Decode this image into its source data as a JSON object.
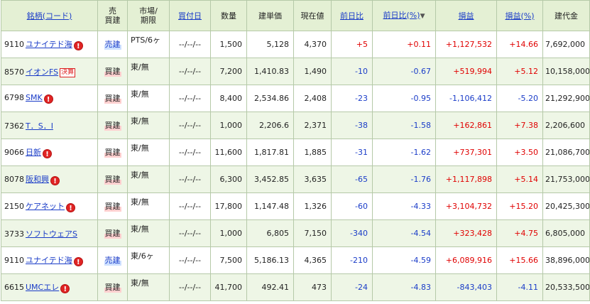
{
  "columns": {
    "name": "銘柄(コード)",
    "side": [
      "売",
      "買建"
    ],
    "market": [
      "市場/",
      "期限"
    ],
    "date": "買付日",
    "qty": "数量",
    "cost": "建単価",
    "price": "現在値",
    "chg": "前日比",
    "chg_pct": "前日比(%)",
    "sort_icon": "▼",
    "pl": "損益",
    "pl_pct": "損益(%)",
    "amount": "建代金"
  },
  "rows": [
    {
      "code": "9110",
      "name": "ユナイテド海",
      "alert": "!",
      "badge": "",
      "side": "売建",
      "side_type": "sell",
      "market": "PTS/6ヶ",
      "date": "--/--/--",
      "qty": "1,500",
      "cost": "5,128",
      "price": "4,370",
      "chg": "+5",
      "chg_sign": "pos",
      "chg_pct": "+0.11",
      "chg_pct_sign": "pos",
      "pl": "+1,127,532",
      "pl_sign": "pos",
      "pl_pct": "+14.66",
      "pl_pct_sign": "pos",
      "amount": "7,692,000"
    },
    {
      "code": "8570",
      "name": "イオンFS",
      "alert": "",
      "badge": "決算",
      "side": "買建",
      "side_type": "buy",
      "market": "東/無",
      "date": "--/--/--",
      "qty": "7,200",
      "cost": "1,410.83",
      "price": "1,490",
      "chg": "-10",
      "chg_sign": "neg",
      "chg_pct": "-0.67",
      "chg_pct_sign": "neg",
      "pl": "+519,994",
      "pl_sign": "pos",
      "pl_pct": "+5.12",
      "pl_pct_sign": "pos",
      "amount": "10,158,000"
    },
    {
      "code": "6798",
      "name": "SMK",
      "alert": "!",
      "badge": "",
      "side": "買建",
      "side_type": "buy",
      "market": "東/無",
      "date": "--/--/--",
      "qty": "8,400",
      "cost": "2,534.86",
      "price": "2,408",
      "chg": "-23",
      "chg_sign": "neg",
      "chg_pct": "-0.95",
      "chg_pct_sign": "neg",
      "pl": "-1,106,412",
      "pl_sign": "neg",
      "pl_pct": "-5.20",
      "pl_pct_sign": "neg",
      "amount": "21,292,900"
    },
    {
      "code": "7362",
      "name": "T．S．I",
      "alert": "",
      "badge": "",
      "side": "買建",
      "side_type": "buy",
      "market": "東/無",
      "date": "--/--/--",
      "qty": "1,000",
      "cost": "2,206.6",
      "price": "2,371",
      "chg": "-38",
      "chg_sign": "neg",
      "chg_pct": "-1.58",
      "chg_pct_sign": "neg",
      "pl": "+162,861",
      "pl_sign": "pos",
      "pl_pct": "+7.38",
      "pl_pct_sign": "pos",
      "amount": "2,206,600"
    },
    {
      "code": "9066",
      "name": "日新",
      "alert": "!",
      "badge": "",
      "side": "買建",
      "side_type": "buy",
      "market": "東/無",
      "date": "--/--/--",
      "qty": "11,600",
      "cost": "1,817.81",
      "price": "1,885",
      "chg": "-31",
      "chg_sign": "neg",
      "chg_pct": "-1.62",
      "chg_pct_sign": "neg",
      "pl": "+737,301",
      "pl_sign": "pos",
      "pl_pct": "+3.50",
      "pl_pct_sign": "pos",
      "amount": "21,086,700"
    },
    {
      "code": "8078",
      "name": "阪和興",
      "alert": "!",
      "badge": "",
      "side": "買建",
      "side_type": "buy",
      "market": "東/無",
      "date": "--/--/--",
      "qty": "6,300",
      "cost": "3,452.85",
      "price": "3,635",
      "chg": "-65",
      "chg_sign": "neg",
      "chg_pct": "-1.76",
      "chg_pct_sign": "neg",
      "pl": "+1,117,898",
      "pl_sign": "pos",
      "pl_pct": "+5.14",
      "pl_pct_sign": "pos",
      "amount": "21,753,000"
    },
    {
      "code": "2150",
      "name": "ケアネット",
      "alert": "!",
      "badge": "",
      "side": "買建",
      "side_type": "buy",
      "market": "東/無",
      "date": "--/--/--",
      "qty": "17,800",
      "cost": "1,147.48",
      "price": "1,326",
      "chg": "-60",
      "chg_sign": "neg",
      "chg_pct": "-4.33",
      "chg_pct_sign": "neg",
      "pl": "+3,104,732",
      "pl_sign": "pos",
      "pl_pct": "+15.20",
      "pl_pct_sign": "pos",
      "amount": "20,425,300"
    },
    {
      "code": "3733",
      "name": "ソフトウェアS",
      "alert": "",
      "badge": "",
      "side": "買建",
      "side_type": "buy",
      "market": "東/無",
      "date": "--/--/--",
      "qty": "1,000",
      "cost": "6,805",
      "price": "7,150",
      "chg": "-340",
      "chg_sign": "neg",
      "chg_pct": "-4.54",
      "chg_pct_sign": "neg",
      "pl": "+323,428",
      "pl_sign": "pos",
      "pl_pct": "+4.75",
      "pl_pct_sign": "pos",
      "amount": "6,805,000"
    },
    {
      "code": "9110",
      "name": "ユナイテド海",
      "alert": "!",
      "badge": "",
      "side": "売建",
      "side_type": "sell",
      "market": "東/6ヶ",
      "date": "--/--/--",
      "qty": "7,500",
      "cost": "5,186.13",
      "price": "4,365",
      "chg": "-210",
      "chg_sign": "neg",
      "chg_pct": "-4.59",
      "chg_pct_sign": "neg",
      "pl": "+6,089,916",
      "pl_sign": "pos",
      "pl_pct": "+15.66",
      "pl_pct_sign": "pos",
      "amount": "38,896,000"
    },
    {
      "code": "6615",
      "name": "UMCエレ",
      "alert": "!",
      "badge": "",
      "side": "買建",
      "side_type": "buy",
      "market": "東/無",
      "date": "--/--/--",
      "qty": "41,700",
      "cost": "492.41",
      "price": "473",
      "chg": "-24",
      "chg_sign": "neg",
      "chg_pct": "-4.83",
      "chg_pct_sign": "neg",
      "pl": "-843,403",
      "pl_sign": "neg",
      "pl_pct": "-4.11",
      "pl_pct_sign": "neg",
      "amount": "20,533,500"
    }
  ]
}
